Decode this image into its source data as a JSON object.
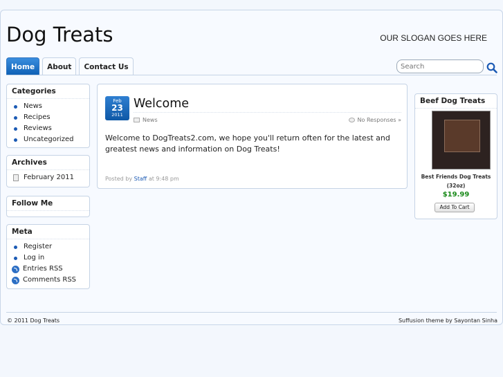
{
  "site": {
    "title": "Dog Treats",
    "slogan": "OUR SLOGAN GOES HERE"
  },
  "nav": {
    "tabs": [
      {
        "label": "Home"
      },
      {
        "label": "About"
      },
      {
        "label": "Contact Us"
      }
    ]
  },
  "search": {
    "placeholder": "Search"
  },
  "sidebar": {
    "categories": {
      "title": "Categories",
      "items": [
        "News",
        "Recipes",
        "Reviews",
        "Uncategorized"
      ]
    },
    "archives": {
      "title": "Archives",
      "items": [
        "February 2011"
      ]
    },
    "follow": {
      "title": "Follow Me"
    },
    "meta": {
      "title": "Meta",
      "items": [
        "Register",
        "Log in",
        "Entries RSS",
        "Comments RSS"
      ]
    }
  },
  "post": {
    "date": {
      "month": "Feb",
      "day": "23",
      "year": "2011"
    },
    "title": "Welcome",
    "category": "News",
    "comments": "No Responses »",
    "body": "Welcome to DogTreats2.com, we hope you'll return often for the latest and greatest news and information on Dog Treats!",
    "posted_by_prefix": "Posted by",
    "author": "Staff",
    "time": "at 9:48 pm"
  },
  "product_widget": {
    "title": "Beef Dog Treats",
    "name": "Best Friends Dog Treats (32oz)",
    "price": "$19.99",
    "button": "Add To Cart"
  },
  "footer": {
    "left": "© 2011 Dog Treats",
    "right": "Suffusion theme by Sayontan Sinha"
  },
  "colors": {
    "accent": "#1b5ab4",
    "price": "#1a8a1a",
    "background": "#f3f7fd"
  }
}
